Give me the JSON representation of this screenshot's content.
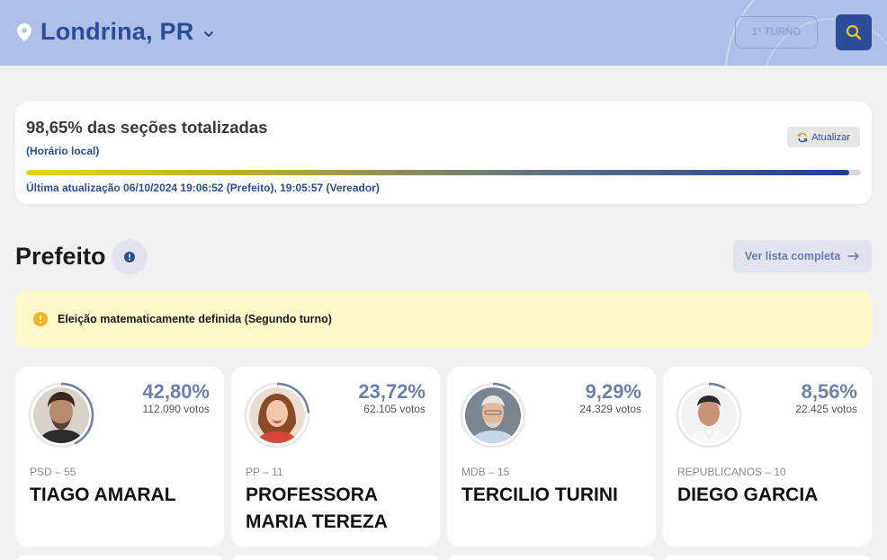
{
  "header": {
    "city": "Londrina, PR",
    "turno_label": "1º TURNO",
    "pin_icon": "map-pin-icon",
    "chevron_icon": "chevron-down-icon",
    "search_icon": "search-icon",
    "accent_color": "#2b4c98",
    "bar_color": "#aec0e8"
  },
  "status": {
    "title": "98,65% das seções totalizadas",
    "progress_percent": 98.65,
    "horario": "(Horário local)",
    "refresh_label": "Atualizar",
    "last_update": "Última atualização 06/10/2024 19:06:52 (Prefeito), 19:05:57 (Vereador)"
  },
  "section": {
    "title": "Prefeito",
    "info_icon": "info-icon",
    "ver_lista_label": "Ver lista completa",
    "arrow_icon": "arrow-right-icon"
  },
  "alert": {
    "icon": "info-icon",
    "text": "Eleição matematicamente definida (Segundo turno)",
    "bg_color": "#fdf8c9"
  },
  "candidates": [
    {
      "percent": "42,80%",
      "percent_value": 42.8,
      "votes": "112.090 votos",
      "party": "PSD – 55",
      "name": "TIAGO AMARAL"
    },
    {
      "percent": "23,72%",
      "percent_value": 23.72,
      "votes": "62.105 votos",
      "party": "PP – 11",
      "name": "PROFESSORA MARIA TEREZA"
    },
    {
      "percent": "9,29%",
      "percent_value": 9.29,
      "votes": "24.329 votos",
      "party": "MDB – 15",
      "name": "TERCILIO TURINI"
    },
    {
      "percent": "8,56%",
      "percent_value": 8.56,
      "votes": "22.425 votos",
      "party": "REPUBLICANOS – 10",
      "name": "DIEGO GARCIA"
    }
  ]
}
